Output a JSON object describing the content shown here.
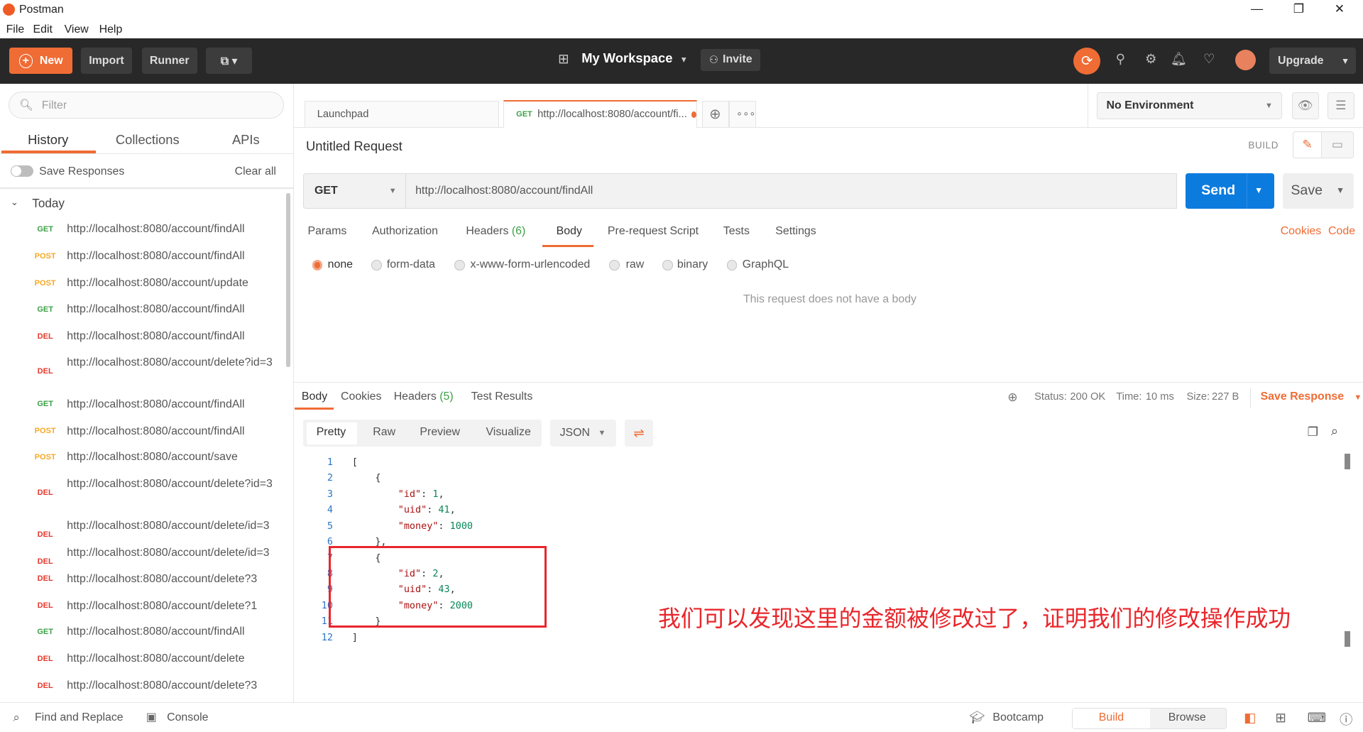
{
  "window": {
    "title": "Postman",
    "controls": [
      "—",
      "❐",
      "✕"
    ]
  },
  "menu": [
    "File",
    "Edit",
    "View",
    "Help"
  ],
  "header": {
    "new_label": "New",
    "import_label": "Import",
    "runner_label": "Runner",
    "workspace_label": "My Workspace",
    "invite_label": "Invite",
    "upgrade_label": "Upgrade"
  },
  "sidebar": {
    "filter_placeholder": "Filter",
    "tabs": [
      "History",
      "Collections",
      "APIs"
    ],
    "save_responses_label": "Save Responses",
    "clear_all_label": "Clear all",
    "group_label": "Today",
    "history": [
      {
        "method": "GET",
        "url": "http://localhost:8080/account/findAll"
      },
      {
        "method": "POST",
        "url": "http://localhost:8080/account/findAll"
      },
      {
        "method": "POST",
        "url": "http://localhost:8080/account/update"
      },
      {
        "method": "GET",
        "url": "http://localhost:8080/account/findAll"
      },
      {
        "method": "DEL",
        "url": "http://localhost:8080/account/findAll"
      },
      {
        "method": "DEL",
        "url": "http://localhost:8080/account/delete?id=3"
      },
      {
        "method": "GET",
        "url": "http://localhost:8080/account/findAll"
      },
      {
        "method": "POST",
        "url": "http://localhost:8080/account/findAll"
      },
      {
        "method": "POST",
        "url": "http://localhost:8080/account/save"
      },
      {
        "method": "DEL",
        "url": "http://localhost:8080/account/delete?id=3"
      },
      {
        "method": "DEL",
        "url": "http://localhost:8080/account/delete/id=3"
      },
      {
        "method": "DEL",
        "url": "http://localhost:8080/account/delete/id=3"
      },
      {
        "method": "DEL",
        "url": "http://localhost:8080/account/delete?3"
      },
      {
        "method": "DEL",
        "url": "http://localhost:8080/account/delete?1"
      },
      {
        "method": "GET",
        "url": "http://localhost:8080/account/findAll"
      },
      {
        "method": "DEL",
        "url": "http://localhost:8080/account/delete"
      },
      {
        "method": "DEL",
        "url": "http://localhost:8080/account/delete?3"
      }
    ]
  },
  "tabs": {
    "launchpad": "Launchpad",
    "active_method": "GET",
    "active_url": "http://localhost:8080/account/fi..."
  },
  "environment": {
    "selected": "No Environment"
  },
  "request": {
    "title": "Untitled Request",
    "build_label": "BUILD",
    "method": "GET",
    "url": "http://localhost:8080/account/findAll",
    "send_label": "Send",
    "save_label": "Save",
    "tabs": [
      "Params",
      "Authorization",
      "Headers (6)",
      "Body",
      "Pre-request Script",
      "Tests",
      "Settings"
    ],
    "links": [
      "Cookies",
      "Code"
    ],
    "body_types": [
      "none",
      "form-data",
      "x-www-form-urlencoded",
      "raw",
      "binary",
      "GraphQL"
    ],
    "no_body_text": "This request does not have a body"
  },
  "response": {
    "tabs": [
      "Body",
      "Cookies",
      "Headers (5)",
      "Test Results"
    ],
    "status_label": "Status:",
    "status_value": "200 OK",
    "time_label": "Time:",
    "time_value": "10 ms",
    "size_label": "Size:",
    "size_value": "227 B",
    "save_response_label": "Save Response",
    "views": [
      "Pretty",
      "Raw",
      "Preview",
      "Visualize"
    ],
    "format": "JSON",
    "lines": [
      {
        "n": "1",
        "text": "["
      },
      {
        "n": "2",
        "text": "    {"
      },
      {
        "n": "3",
        "text": "        \"id\": 1,"
      },
      {
        "n": "4",
        "text": "        \"uid\": 41,"
      },
      {
        "n": "5",
        "text": "        \"money\": 1000"
      },
      {
        "n": "6",
        "text": "    },"
      },
      {
        "n": "7",
        "text": "    {"
      },
      {
        "n": "8",
        "text": "        \"id\": 2,"
      },
      {
        "n": "9",
        "text": "        \"uid\": 43,"
      },
      {
        "n": "10",
        "text": "        \"money\": 2000"
      },
      {
        "n": "11",
        "text": "    }"
      },
      {
        "n": "12",
        "text": "]"
      }
    ]
  },
  "annotation": "我们可以发现这里的金额被修改过了，证明我们的修改操作成功",
  "footer": {
    "find_replace": "Find and Replace",
    "console": "Console",
    "bootcamp": "Bootcamp",
    "build": "Build",
    "browse": "Browse"
  },
  "colors": {
    "accent": "#ef6c35",
    "send": "#0c7bde",
    "annotation": "#e8262b"
  }
}
